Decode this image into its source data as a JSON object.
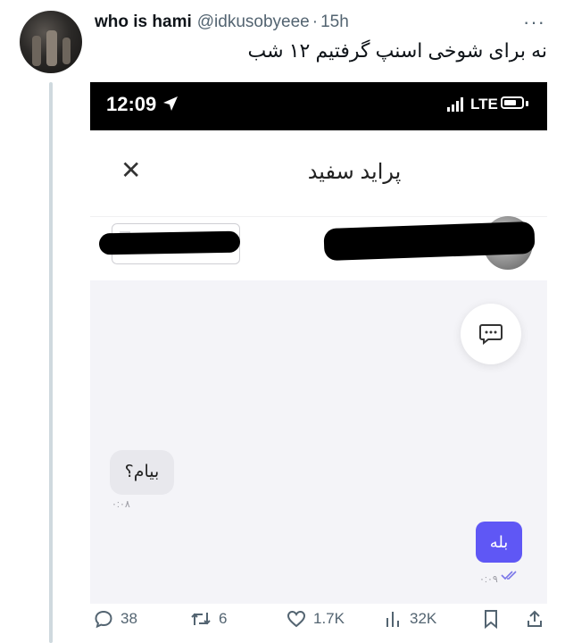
{
  "tweet": {
    "display_name": "who is hami",
    "handle": "@idkusobyeee",
    "separator": "·",
    "time": "15h",
    "more_label": "···",
    "text": "نه برای شوخی اسنپ گرفتیم ۱۲ شب"
  },
  "screenshot": {
    "status_bar": {
      "time": "12:09",
      "network": "LTE"
    },
    "chat": {
      "title": "پراید سفید",
      "close_label": "✕",
      "messages": [
        {
          "direction": "incoming",
          "text": "بیام؟",
          "time": "۰:۰۸"
        },
        {
          "direction": "outgoing",
          "text": "بله",
          "time": "۰:۰۹"
        }
      ]
    }
  },
  "actions": {
    "replies": "38",
    "retweets": "6",
    "likes": "1.7K",
    "views": "32K"
  },
  "colors": {
    "accent": "#5f57f5",
    "muted_text": "#536471",
    "chat_background": "#f4f4f8"
  }
}
